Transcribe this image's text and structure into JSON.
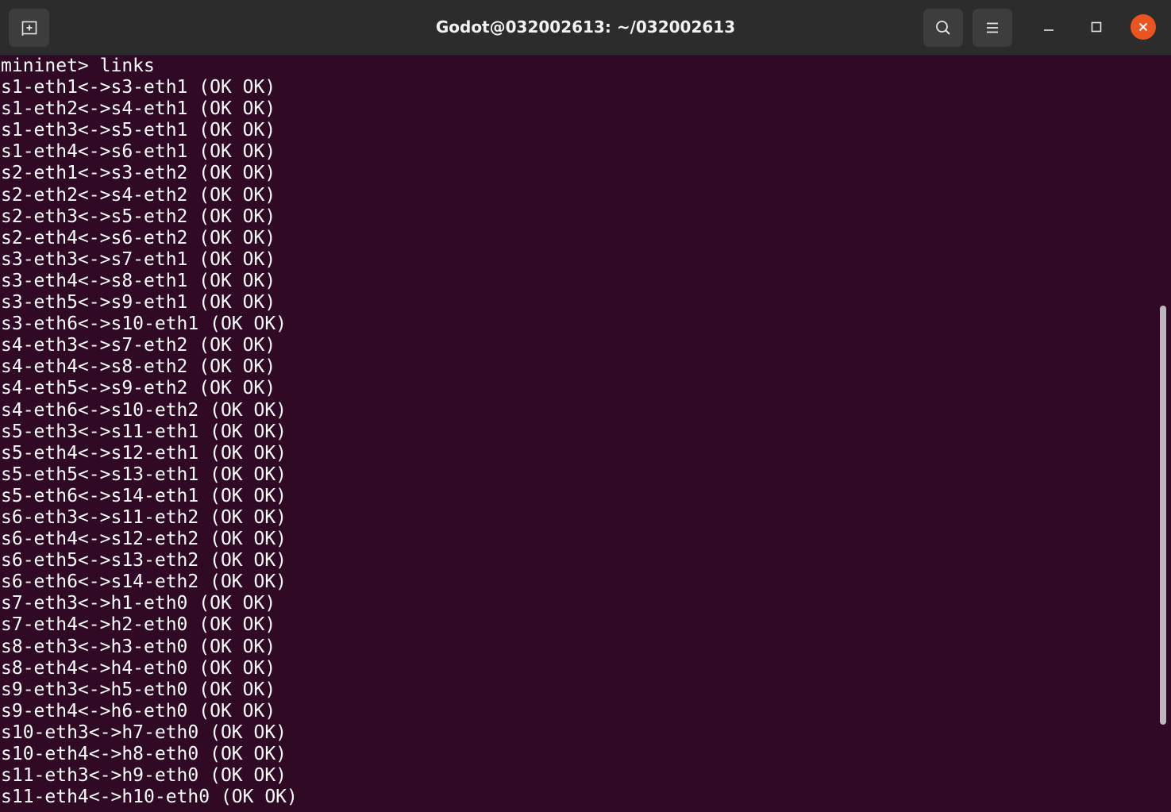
{
  "window": {
    "title": "Godot@032002613: ~/032002613"
  },
  "titlebar_icons": {
    "new_tab": "new-tab-icon",
    "search": "search-icon",
    "menu": "hamburger-menu-icon",
    "minimize": "minimize-icon",
    "maximize": "maximize-icon",
    "close": "close-icon"
  },
  "colors": {
    "terminal_bg": "#300a24",
    "titlebar_bg": "#2c2c2c",
    "close_accent": "#e95420",
    "text": "#ffffff"
  },
  "terminal": {
    "lines": [
      "mininet> links",
      "s1-eth1<->s3-eth1 (OK OK)",
      "s1-eth2<->s4-eth1 (OK OK)",
      "s1-eth3<->s5-eth1 (OK OK)",
      "s1-eth4<->s6-eth1 (OK OK)",
      "s2-eth1<->s3-eth2 (OK OK)",
      "s2-eth2<->s4-eth2 (OK OK)",
      "s2-eth3<->s5-eth2 (OK OK)",
      "s2-eth4<->s6-eth2 (OK OK)",
      "s3-eth3<->s7-eth1 (OK OK)",
      "s3-eth4<->s8-eth1 (OK OK)",
      "s3-eth5<->s9-eth1 (OK OK)",
      "s3-eth6<->s10-eth1 (OK OK)",
      "s4-eth3<->s7-eth2 (OK OK)",
      "s4-eth4<->s8-eth2 (OK OK)",
      "s4-eth5<->s9-eth2 (OK OK)",
      "s4-eth6<->s10-eth2 (OK OK)",
      "s5-eth3<->s11-eth1 (OK OK)",
      "s5-eth4<->s12-eth1 (OK OK)",
      "s5-eth5<->s13-eth1 (OK OK)",
      "s5-eth6<->s14-eth1 (OK OK)",
      "s6-eth3<->s11-eth2 (OK OK)",
      "s6-eth4<->s12-eth2 (OK OK)",
      "s6-eth5<->s13-eth2 (OK OK)",
      "s6-eth6<->s14-eth2 (OK OK)",
      "s7-eth3<->h1-eth0 (OK OK)",
      "s7-eth4<->h2-eth0 (OK OK)",
      "s8-eth3<->h3-eth0 (OK OK)",
      "s8-eth4<->h4-eth0 (OK OK)",
      "s9-eth3<->h5-eth0 (OK OK)",
      "s9-eth4<->h6-eth0 (OK OK)",
      "s10-eth3<->h7-eth0 (OK OK)",
      "s10-eth4<->h8-eth0 (OK OK)",
      "s11-eth3<->h9-eth0 (OK OK)",
      "s11-eth4<->h10-eth0 (OK OK)"
    ]
  }
}
